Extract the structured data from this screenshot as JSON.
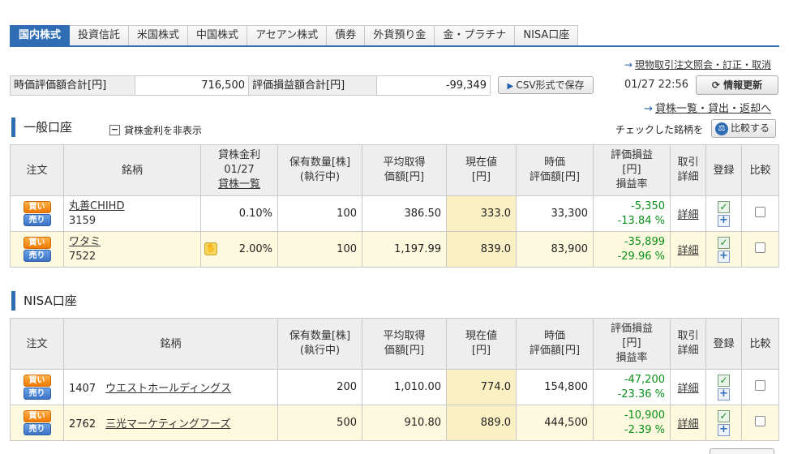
{
  "tabs": [
    "国内株式",
    "投資信託",
    "米国株式",
    "中国株式",
    "アセアン株式",
    "債券",
    "外貨預り金",
    "金・プラチナ",
    "NISA口座"
  ],
  "top_link": "現物取引注文照会・訂正・取消",
  "summary": {
    "market_value_label": "時価評価額合計[円]",
    "market_value": "716,500",
    "pl_label": "評価損益額合計[円]",
    "pl_value": "-99,349"
  },
  "csv_button": "CSV形式で保存",
  "timestamp": "01/27 22:56",
  "refresh_button": "情報更新",
  "lend_link": "貸株一覧・貸出・返却へ",
  "general": {
    "title": "一般口座",
    "toggle_label": "貸株金利を非表示",
    "compare_label": "チェックした銘柄を",
    "compare_button": "比較する",
    "headers": {
      "order": "注文",
      "name": "銘柄",
      "rate_line1": "貸株金利",
      "rate_line2": "01/27",
      "rate_link": "貸株一覧",
      "qty_line1": "保有数量[株]",
      "qty_line2": "(執行中)",
      "avg_line1": "平均取得",
      "avg_line2": "価額[円]",
      "price_line1": "現在値",
      "price_line2": "[円]",
      "mv_line1": "時価",
      "mv_line2": "評価額[円]",
      "pl_line1": "評価損益",
      "pl_line2": "[円]",
      "pl_line3": "損益率",
      "detail_line1": "取引",
      "detail_line2": "詳細",
      "register": "登録",
      "compare": "比較"
    },
    "rows": [
      {
        "name": "丸善CHIHD",
        "code": "3159",
        "rate": "0.10%",
        "qty": "100",
        "avg": "386.50",
        "price": "333.0",
        "mv": "33,300",
        "pl": "-5,350",
        "pl_rate": "-13.84 %",
        "detail": "詳細"
      },
      {
        "name": "ワタミ",
        "code": "7522",
        "rate": "2.00%",
        "qty": "100",
        "avg": "1,197.99",
        "price": "839.0",
        "mv": "83,900",
        "pl": "-35,899",
        "pl_rate": "-29.96 %",
        "detail": "詳細"
      }
    ]
  },
  "nisa": {
    "title": "NISA口座",
    "rows": [
      {
        "code": "1407",
        "name": "ウエストホールディングス",
        "qty": "200",
        "avg": "1,010.00",
        "price": "774.0",
        "mv": "154,800",
        "pl": "-47,200",
        "pl_rate": "-23.36 %",
        "detail": "詳細"
      },
      {
        "code": "2762",
        "name": "三光マーケティングフーズ",
        "qty": "500",
        "avg": "910.80",
        "price": "889.0",
        "mv": "444,500",
        "pl": "-10,900",
        "pl_rate": "-2.39 %",
        "detail": "詳細"
      }
    ]
  },
  "order_buttons": {
    "buy": "買い",
    "sell": "売り"
  },
  "colors": {
    "accent": "#2f6db5",
    "positive_loss_text": "#0a8f1a",
    "price_bg": "#fbf0c4",
    "alt_row_bg": "#fdf9df"
  },
  "icons": {
    "refresh": "refresh-icon",
    "compare": "scale-icon",
    "check": "check-icon",
    "plus": "plus-icon",
    "lend": "lend-badge-icon"
  }
}
